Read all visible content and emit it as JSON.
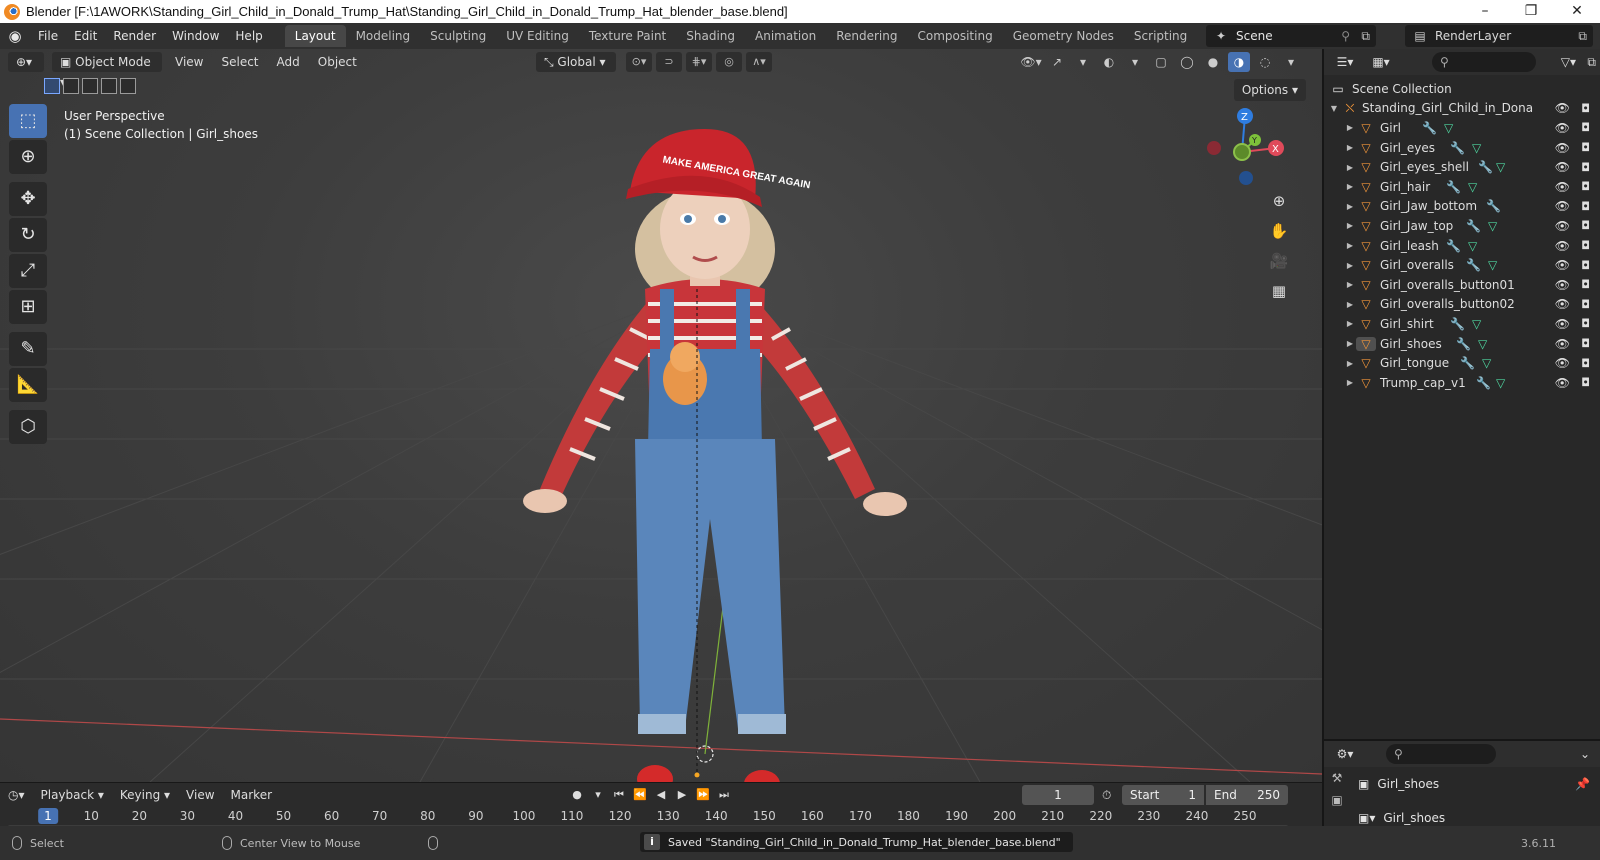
{
  "window": {
    "title": "Blender [F:\\1AWORK\\Standing_Girl_Child_in_Donald_Trump_Hat\\Standing_Girl_Child_in_Donald_Trump_Hat_blender_base.blend]",
    "minimize": "–",
    "maximize": "❐",
    "close": "✕"
  },
  "menubar": {
    "items": [
      "File",
      "Edit",
      "Render",
      "Window",
      "Help"
    ],
    "workspaces": [
      "Layout",
      "Modeling",
      "Sculpting",
      "UV Editing",
      "Texture Paint",
      "Shading",
      "Animation",
      "Rendering",
      "Compositing",
      "Geometry Nodes",
      "Scripting",
      "+"
    ],
    "active_workspace": "Layout",
    "scene": "Scene",
    "render_layer": "RenderLayer"
  },
  "viewport": {
    "mode": "Object Mode",
    "menus": [
      "View",
      "Select",
      "Add",
      "Object"
    ],
    "orientation": "Global",
    "options": "Options",
    "info_line1": "User Perspective",
    "info_line2": "(1) Scene Collection | Girl_shoes",
    "gizmo": {
      "z": "Z",
      "x": "X",
      "y": "Y"
    },
    "cap_text": "MAKE AMERICA GREAT AGAIN"
  },
  "outliner": {
    "search_placeholder": "",
    "scene_collection": "Scene Collection",
    "root": "Standing_Girl_Child_in_Dona",
    "objects": [
      {
        "name": "Girl",
        "mod": true,
        "mesh": true
      },
      {
        "name": "Girl_eyes",
        "mod": true,
        "mesh": true
      },
      {
        "name": "Girl_eyes_shell",
        "mod": true,
        "mesh": true
      },
      {
        "name": "Girl_hair",
        "mod": true,
        "mesh": true
      },
      {
        "name": "Girl_Jaw_bottom",
        "mod": true,
        "mesh": false
      },
      {
        "name": "Girl_Jaw_top",
        "mod": true,
        "mesh": true
      },
      {
        "name": "Girl_leash",
        "mod": true,
        "mesh": true
      },
      {
        "name": "Girl_overalls",
        "mod": true,
        "mesh": true
      },
      {
        "name": "Girl_overalls_button01",
        "mod": false,
        "mesh": false
      },
      {
        "name": "Girl_overalls_button02",
        "mod": false,
        "mesh": false
      },
      {
        "name": "Girl_shirt",
        "mod": true,
        "mesh": true
      },
      {
        "name": "Girl_shoes",
        "mod": true,
        "mesh": true,
        "selected": true
      },
      {
        "name": "Girl_tongue",
        "mod": true,
        "mesh": true
      },
      {
        "name": "Trump_cap_v1",
        "mod": true,
        "mesh": true
      }
    ]
  },
  "properties": {
    "object_name": "Girl_shoes",
    "data_name": "Girl_shoes"
  },
  "timeline": {
    "menus": [
      "Playback",
      "Keying",
      "View",
      "Marker"
    ],
    "current_frame": "1",
    "start_label": "Start",
    "start": "1",
    "end_label": "End",
    "end": "250",
    "ruler": [
      "1",
      "10",
      "20",
      "30",
      "40",
      "50",
      "60",
      "70",
      "80",
      "90",
      "100",
      "110",
      "120",
      "130",
      "140",
      "150",
      "160",
      "170",
      "180",
      "190",
      "200",
      "210",
      "220",
      "230",
      "240",
      "250"
    ]
  },
  "statusbar": {
    "select": "Select",
    "center_view": "Center View to Mouse",
    "saved_message": "Saved \"Standing_Girl_Child_in_Donald_Trump_Hat_blender_base.blend\"",
    "version": "3.6.11"
  },
  "colors": {
    "accent": "#4772b3",
    "object_icon": "#f0953a",
    "modifier_icon": "#7da5e8",
    "mesh_icon": "#4fd6a0"
  }
}
